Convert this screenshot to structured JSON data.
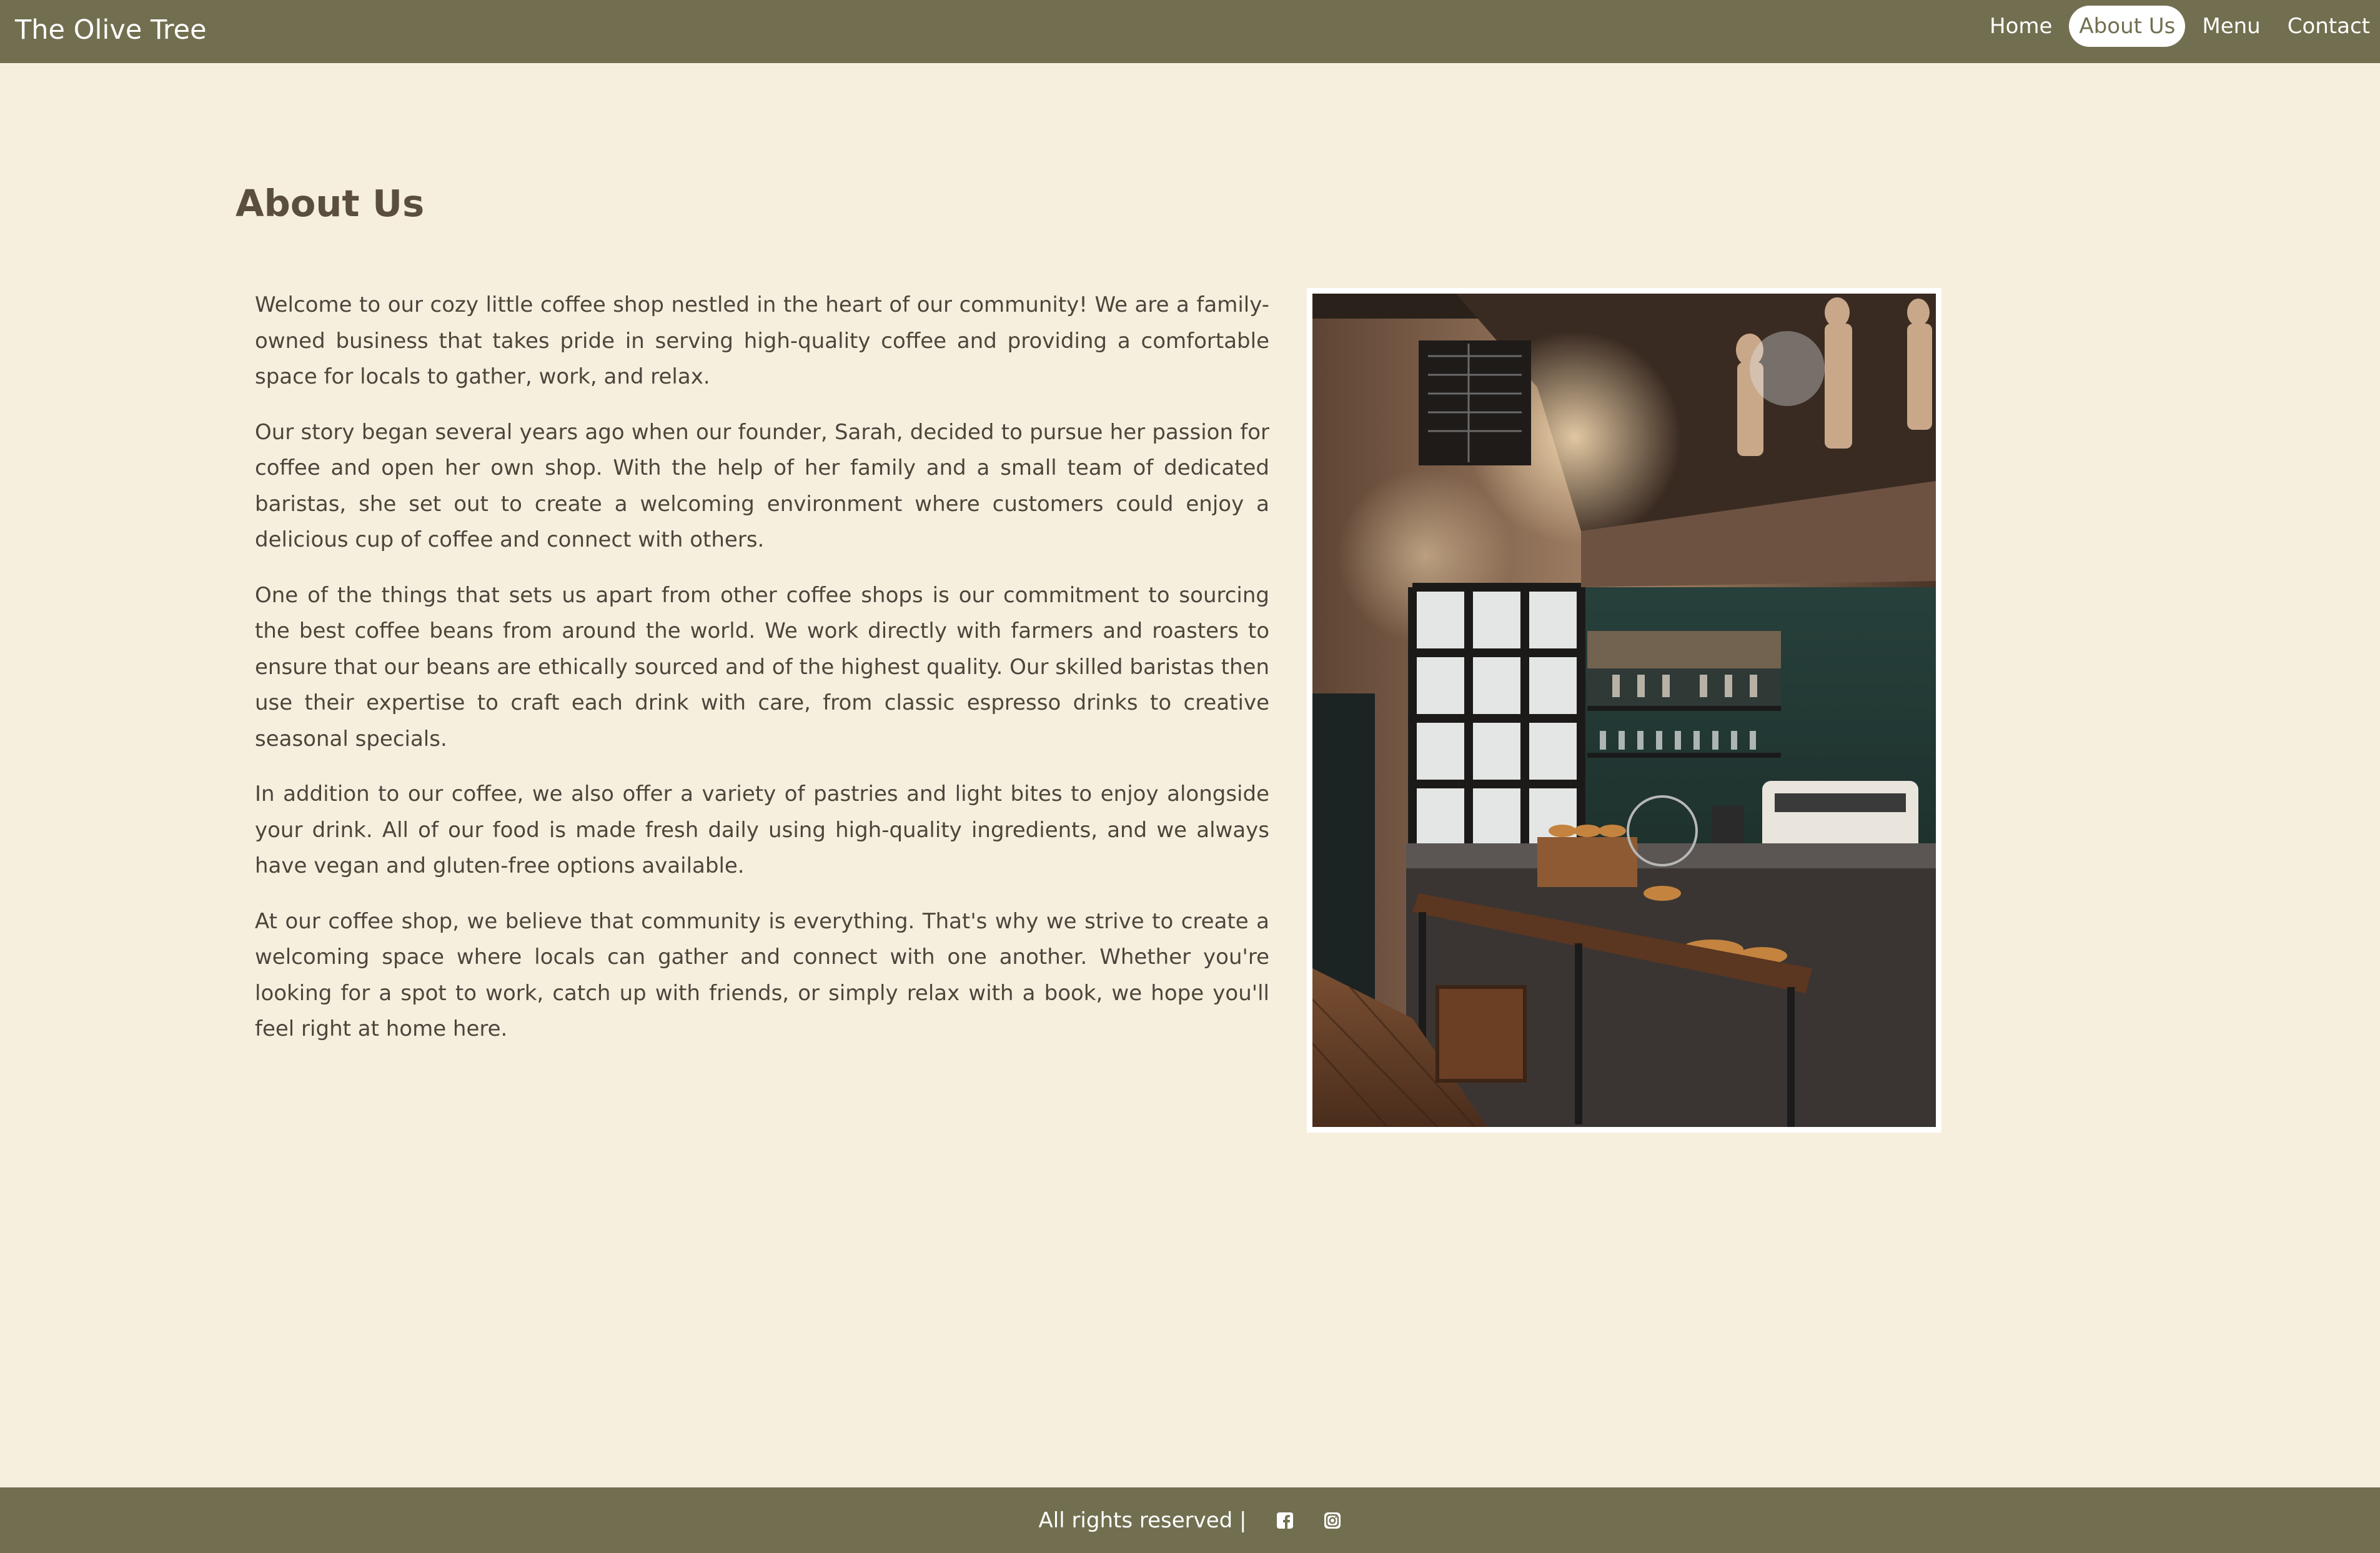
{
  "header": {
    "brand": "The Olive Tree",
    "nav": [
      {
        "label": "Home",
        "active": false
      },
      {
        "label": "About Us",
        "active": true
      },
      {
        "label": "Menu",
        "active": false
      },
      {
        "label": "Contact",
        "active": false
      }
    ]
  },
  "main": {
    "title": "About Us",
    "paragraphs": [
      "Welcome to our cozy little coffee shop nestled in the heart of our community! We are a family-owned business that takes pride in serving high-quality coffee and providing a comfortable space for locals to gather, work, and relax.",
      "Our story began several years ago when our founder, Sarah, decided to pursue her passion for coffee and open her own shop. With the help of her family and a small team of dedicated baristas, she set out to create a welcoming environment where customers could enjoy a delicious cup of coffee and connect with others.",
      "One of the things that sets us apart from other coffee shops is our commitment to sourcing the best coffee beans from around the world. We work directly with farmers and roasters to ensure that our beans are ethically sourced and of the highest quality. Our skilled baristas then use their expertise to craft each drink with care, from classic espresso drinks to creative seasonal specials.",
      "In addition to our coffee, we also offer a variety of pastries and light bites to enjoy alongside your drink. All of our food is made fresh daily using high-quality ingredients, and we always have vegan and gluten-free options available.",
      "At our coffee shop, we believe that community is everything. That's why we strive to create a welcoming space where locals can gather and connect with one another. Whether you're looking for a spot to work, catch up with friends, or simply relax with a book, we hope you'll feel right at home here."
    ]
  },
  "footer": {
    "text": "All rights reserved |",
    "icons": [
      "facebook-icon",
      "instagram-icon"
    ]
  },
  "colors": {
    "header_bg": "#726f50",
    "page_bg": "#f7efde",
    "title": "#5a4f3e",
    "text": "#4c453b"
  }
}
